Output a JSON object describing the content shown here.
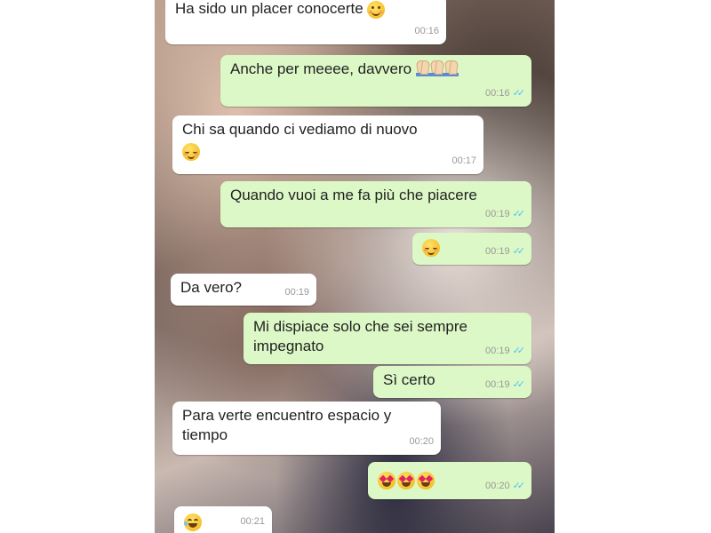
{
  "messages": [
    {
      "id": "m1",
      "direction": "in",
      "text": "Ha sido un placer conocerte",
      "emoji": [
        "smile"
      ],
      "time": "00:16"
    },
    {
      "id": "m2",
      "direction": "out",
      "text": "Anche per meeee, davvero",
      "emoji": [
        "folded-hands",
        "folded-hands",
        "folded-hands"
      ],
      "time": "00:16",
      "status": "read"
    },
    {
      "id": "m3",
      "direction": "in",
      "text": "Chi sa quando ci vediamo di nuovo",
      "emoji": [
        "relieved"
      ],
      "time": "00:17"
    },
    {
      "id": "m4",
      "direction": "out",
      "text": "Quando vuoi a me fa più che piacere",
      "time": "00:19",
      "status": "read"
    },
    {
      "id": "m5",
      "direction": "out",
      "text": "",
      "emoji": [
        "relieved"
      ],
      "time": "00:19",
      "status": "read"
    },
    {
      "id": "m6",
      "direction": "in",
      "text": "Da vero?",
      "time": "00:19"
    },
    {
      "id": "m7",
      "direction": "out",
      "text": "Mi dispiace solo che sei sempre\nimpegnato",
      "time": "00:19",
      "status": "read"
    },
    {
      "id": "m8",
      "direction": "out",
      "text": "Sì certo",
      "time": "00:19",
      "status": "read"
    },
    {
      "id": "m9",
      "direction": "in",
      "text": "Para verte encuentro espacio y\ntiempo",
      "time": "00:20"
    },
    {
      "id": "m10",
      "direction": "out",
      "text": "",
      "emoji": [
        "heart-eyes",
        "heart-eyes",
        "heart-eyes"
      ],
      "time": "00:20",
      "status": "read"
    },
    {
      "id": "m11",
      "direction": "in",
      "text": "",
      "emoji": [
        "laughing"
      ],
      "time": "00:21"
    }
  ],
  "colors": {
    "incoming_bubble": "#ffffff",
    "outgoing_bubble": "#dcf8c6",
    "read_tick": "#4fc3f7"
  },
  "read_tick_glyph": "✓✓"
}
